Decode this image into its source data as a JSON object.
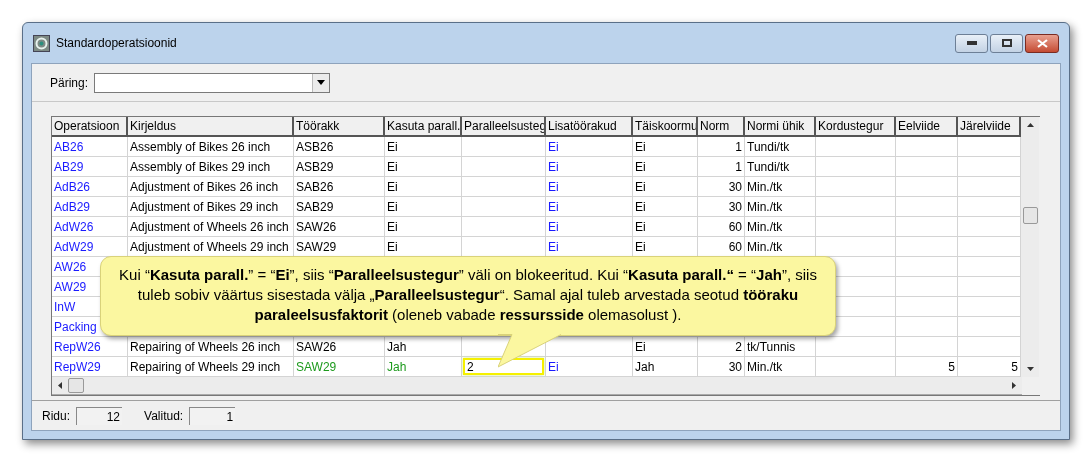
{
  "window": {
    "title": "Standardoperatsioonid"
  },
  "query": {
    "label": "Päring:"
  },
  "table": {
    "columns": [
      {
        "label": "Operatsioon",
        "kind": "link"
      },
      {
        "label": "Kirjeldus",
        "kind": "text"
      },
      {
        "label": "Töörakk",
        "kind": "text"
      },
      {
        "label": "Kasuta parall.",
        "kind": "text"
      },
      {
        "label": "Paralleelsusteg",
        "kind": "factor"
      },
      {
        "label": "Lisatöörakud",
        "kind": "link"
      },
      {
        "label": "Täiskoormu",
        "kind": "text"
      },
      {
        "label": "Norm",
        "kind": "number"
      },
      {
        "label": "Normi ühik",
        "kind": "text"
      },
      {
        "label": "Kordustegur",
        "kind": "number"
      },
      {
        "label": "Eelviide",
        "kind": "number"
      },
      {
        "label": "Järelviide",
        "kind": "number"
      }
    ],
    "rows": [
      {
        "cells": [
          "AB26",
          "Assembly of Bikes 26 inch",
          "ASB26",
          "Ei",
          null,
          "Ei",
          "Ei",
          "1",
          "Tundi/tk",
          null,
          null,
          null
        ]
      },
      {
        "cells": [
          "AB29",
          "Assembly of Bikes 29 inch",
          "ASB29",
          "Ei",
          null,
          "Ei",
          "Ei",
          "1",
          "Tundi/tk",
          null,
          null,
          null
        ]
      },
      {
        "cells": [
          "AdB26",
          "Adjustment of Bikes 26 inch",
          "SAB26",
          "Ei",
          null,
          "Ei",
          "Ei",
          "30",
          "Min./tk",
          null,
          null,
          null
        ]
      },
      {
        "cells": [
          "AdB29",
          "Adjustment of Bikes 29 inch",
          "SAB29",
          "Ei",
          null,
          "Ei",
          "Ei",
          "30",
          "Min./tk",
          null,
          null,
          null
        ]
      },
      {
        "cells": [
          "AdW26",
          "Adjustment of Wheels 26 inch",
          "SAW26",
          "Ei",
          null,
          "Ei",
          "Ei",
          "60",
          "Min./tk",
          null,
          null,
          null
        ]
      },
      {
        "cells": [
          "AdW29",
          "Adjustment of Wheels 29 inch",
          "SAW29",
          "Ei",
          null,
          "Ei",
          "Ei",
          "60",
          "Min./tk",
          null,
          null,
          null
        ]
      },
      {
        "cells": [
          "AW26",
          null,
          null,
          null,
          null,
          null,
          null,
          null,
          null,
          null,
          null,
          null
        ]
      },
      {
        "cells": [
          "AW29",
          null,
          null,
          null,
          null,
          null,
          null,
          null,
          null,
          null,
          null,
          null
        ]
      },
      {
        "cells": [
          "InW",
          null,
          null,
          null,
          null,
          null,
          null,
          null,
          null,
          null,
          null,
          null
        ]
      },
      {
        "cells": [
          "Packing",
          null,
          null,
          null,
          null,
          null,
          null,
          null,
          null,
          null,
          null,
          null
        ]
      },
      {
        "cells": [
          "RepW26",
          "Repairing of Wheels 26 inch",
          "SAW26",
          "Jah",
          null,
          null,
          "Ei",
          "2",
          "tk/Tunnis",
          null,
          null,
          null
        ]
      },
      {
        "cells": [
          "RepW29",
          "Repairing of Wheels 29 inch",
          {
            "text": "SAW29",
            "changed": true
          },
          {
            "text": "Jah",
            "changed": true
          },
          {
            "text": "2",
            "editing": true
          },
          "Ei",
          "Jah",
          "30",
          "Min./tk",
          null,
          "5",
          "5"
        ]
      }
    ]
  },
  "callout": {
    "text": "Kui “**Kasuta parall.**” = “**Ei**”, siis “**Paralleelsustegur**” väli on blokeeritud.  Kui “**Kasuta parall.“**  = “**Jah**”, siis tuleb sobiv väärtus sisestada välja „**Paralleelsustegur**“. Samal ajal tuleb arvestada seotud **tööraku paraleelsusfaktorit** (oleneb vabade **ressursside** olemasolust )."
  },
  "status_bar": {
    "rows_label": "Ridu:",
    "rows_value": "12",
    "selected_label": "Valitud:",
    "selected_value": "1"
  }
}
